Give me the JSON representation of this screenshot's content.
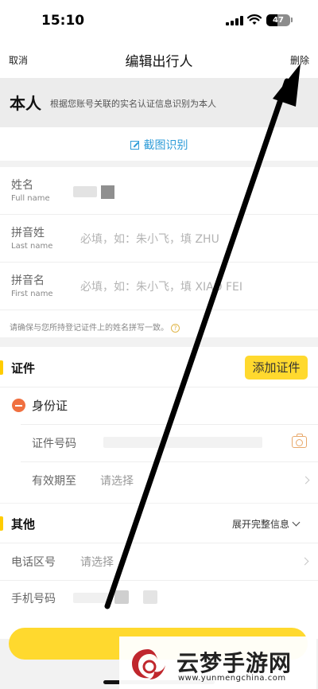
{
  "status_bar": {
    "time": "15:10",
    "battery": "47",
    "battery_level": 0.47
  },
  "nav": {
    "cancel_label": "取消",
    "title": "编辑出行人",
    "delete_label": "删除"
  },
  "self_banner": {
    "title": "本人",
    "description": "根据您账号关联的实名认证信息识别为本人"
  },
  "ocr": {
    "label": "截图识别"
  },
  "name_fields": {
    "name_label": "姓名",
    "name_sublabel": "Full name",
    "last_label": "拼音姓",
    "last_sublabel": "Last name",
    "last_placeholder": "必填，如：朱小飞，填 ZHU",
    "first_label": "拼音名",
    "first_sublabel": "First name",
    "first_placeholder": "必填，如：朱小飞，填 XIAO FEI",
    "hint": "请确保与您所持登记证件上的姓名拼写一致。"
  },
  "certificate": {
    "section_title": "证件",
    "add_button": "添加证件",
    "id_type": "身份证",
    "number_label": "证件号码",
    "expiry_label": "有效期至",
    "expiry_placeholder": "请选择"
  },
  "other": {
    "section_title": "其他",
    "expand_label": "展开完整信息",
    "area_code_label": "电话区号",
    "area_code_placeholder": "请选择",
    "mobile_label": "手机号码"
  },
  "watermark": {
    "name": "云梦手游网",
    "url": "www.yunmengchina.com"
  },
  "colors": {
    "accent": "#ffd92e",
    "link": "#2f9cd8",
    "remove": "#f07040"
  },
  "icons": [
    "crop-scan-icon",
    "help-icon",
    "remove-icon",
    "camera-icon",
    "chevron-right-icon",
    "chevron-down-icon",
    "annotation-arrow"
  ]
}
